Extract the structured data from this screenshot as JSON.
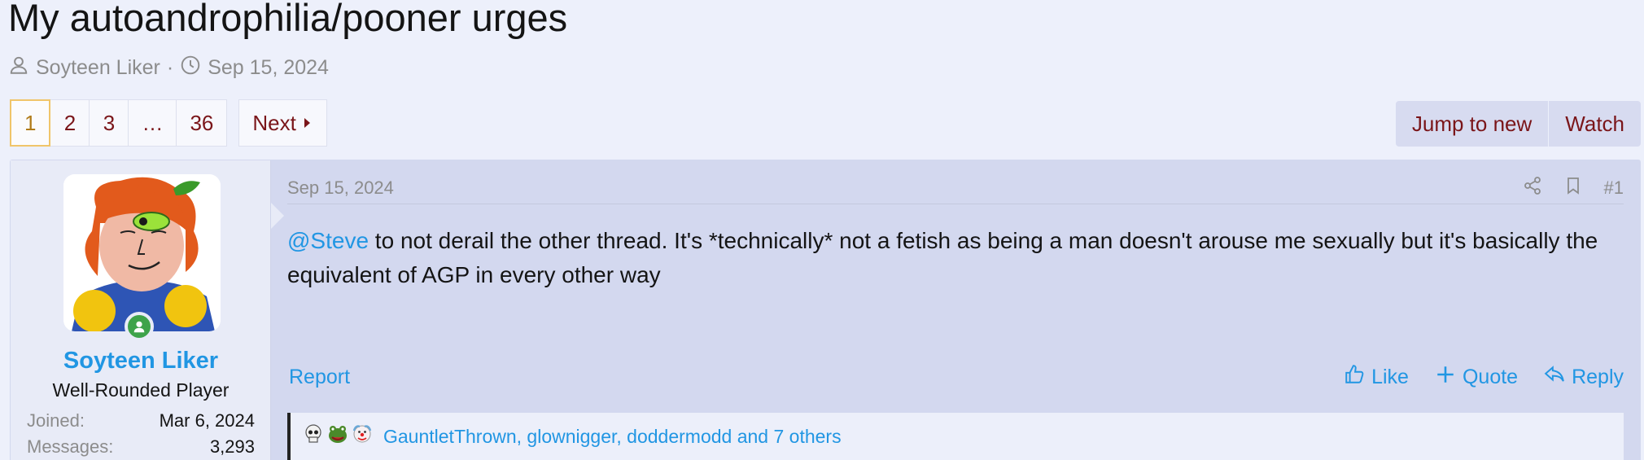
{
  "thread": {
    "title": "My autoandrophilia/pooner urges",
    "author": "Soyteen Liker",
    "separator": "·",
    "date": "Sep 15, 2024"
  },
  "pagination": {
    "pages": [
      "1",
      "2",
      "3",
      "…",
      "36"
    ],
    "current": "1",
    "next_label": "Next"
  },
  "thread_actions": {
    "jump_label": "Jump to new",
    "watch_label": "Watch"
  },
  "post": {
    "user": {
      "name": "Soyteen Liker",
      "title": "Well-Rounded Player",
      "joined_label": "Joined:",
      "joined_value": "Mar 6, 2024",
      "messages_label": "Messages:",
      "messages_value": "3,293"
    },
    "date": "Sep 15, 2024",
    "number": "#1",
    "mention": "@Steve",
    "body": " to not derail the other thread. It's *technically* not a fetish as being a man doesn't arouse me sexually but it's basically the equivalent of AGP in every other way",
    "report_label": "Report",
    "like_label": "Like",
    "quote_label": "Quote",
    "reply_label": "Reply",
    "reactions_text": "GauntletThrown, glownigger, doddermodd and 7 others"
  },
  "colors": {
    "accent_link": "#2196e3",
    "button_text": "#7a1519",
    "current_page_border": "#f0c56a"
  },
  "icons": [
    "user-icon",
    "clock-icon",
    "caret-right-icon",
    "share-icon",
    "bookmark-icon",
    "thumbs-up-icon",
    "plus-icon",
    "reply-icon",
    "skull-icon",
    "frog-icon",
    "clown-icon",
    "online-status-icon"
  ]
}
